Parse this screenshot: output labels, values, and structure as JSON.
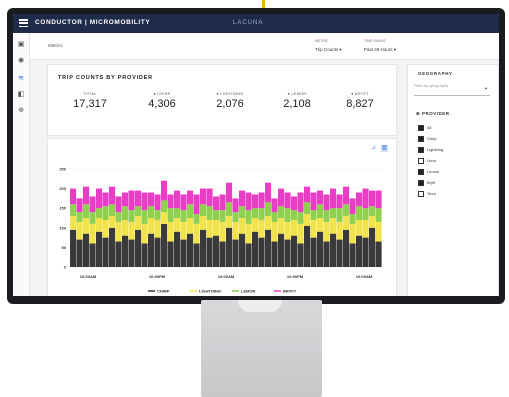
{
  "app": {
    "title": "CONDUCTOR | MICROMOBILITY",
    "brand": "LACUNA"
  },
  "header": {
    "breadcrumb": "Metrics",
    "metric": {
      "label": "METRIC",
      "value": "Trip Counts ▾"
    },
    "time_range": {
      "label": "TIME RANGE",
      "value": "Past 48 Hours ▾"
    }
  },
  "sidebar": {
    "icons": [
      "layers-icon",
      "globe-icon",
      "bike-icon",
      "code-icon",
      "world-icon"
    ]
  },
  "trip_counts": {
    "title": "TRIP COUNTS BY PROVIDER",
    "stats": [
      {
        "label": "TOTAL",
        "value": "17,317"
      },
      {
        "label": "● CHIRP",
        "value": "4,306"
      },
      {
        "label": "● LIGHTNING",
        "value": "2,076"
      },
      {
        "label": "● LEMON",
        "value": "2,108"
      },
      {
        "label": "● BRYFT",
        "value": "8,827"
      }
    ]
  },
  "geography": {
    "title": "GEOGRAPHY",
    "placeholder": "Filter by geography",
    "providers_title": "⊕ PROVIDER",
    "providers": [
      {
        "label": "All",
        "checked": true
      },
      {
        "label": "Chirp",
        "checked": true
      },
      {
        "label": "Lightning",
        "checked": true
      },
      {
        "label": "Lima",
        "checked": false
      },
      {
        "label": "Lemon",
        "checked": true
      },
      {
        "label": "Bryft",
        "checked": true
      },
      {
        "label": "Texxi",
        "checked": false
      }
    ]
  },
  "colors": {
    "chirp": "#3a3a3c",
    "lightning": "#f2e34c",
    "lemon": "#8fd14f",
    "bryft": "#e83dc4",
    "accent": "#3b6fd6"
  },
  "chart_data": {
    "type": "bar",
    "stacked": true,
    "y_ticks": [
      "250",
      "200",
      "150",
      "100",
      "50",
      "0"
    ],
    "ylim": [
      0,
      250
    ],
    "x_ticks": [
      "10:00AM",
      "10:00PM",
      "10:00AM",
      "10:00PM",
      "10:00AM"
    ],
    "legend": [
      "CHIRP",
      "LIGHTNING",
      "LEMON",
      "BRYFT"
    ],
    "series": [
      {
        "name": "CHIRP",
        "values": [
          95,
          70,
          85,
          60,
          90,
          75,
          100,
          65,
          80,
          70,
          95,
          60,
          85,
          75,
          110,
          65,
          90,
          70,
          85,
          60,
          95,
          75,
          80,
          65,
          100,
          70,
          85,
          60,
          90,
          75,
          95,
          65,
          85,
          70,
          80,
          60,
          105,
          75,
          90,
          65,
          85,
          70,
          95,
          60,
          80,
          75,
          100,
          65
        ]
      },
      {
        "name": "LIGHTNING",
        "values": [
          35,
          45,
          40,
          50,
          35,
          45,
          30,
          50,
          40,
          45,
          35,
          50,
          40,
          45,
          30,
          50,
          35,
          45,
          40,
          50,
          35,
          45,
          40,
          50,
          30,
          45,
          40,
          50,
          35,
          45,
          35,
          50,
          40,
          45,
          40,
          50,
          30,
          45,
          35,
          50,
          40,
          45,
          35,
          50,
          40,
          45,
          30,
          50
        ]
      },
      {
        "name": "LEMON",
        "values": [
          30,
          25,
          35,
          30,
          25,
          35,
          30,
          25,
          35,
          30,
          25,
          35,
          30,
          25,
          30,
          35,
          25,
          30,
          35,
          25,
          30,
          35,
          25,
          30,
          35,
          25,
          30,
          35,
          25,
          30,
          35,
          25,
          30,
          35,
          25,
          30,
          30,
          25,
          35,
          30,
          25,
          35,
          30,
          25,
          35,
          30,
          25,
          35
        ]
      },
      {
        "name": "BRYFT",
        "values": [
          40,
          35,
          45,
          40,
          50,
          35,
          45,
          40,
          35,
          50,
          40,
          45,
          35,
          40,
          50,
          35,
          45,
          40,
          35,
          50,
          40,
          45,
          35,
          40,
          50,
          35,
          40,
          45,
          35,
          40,
          50,
          35,
          45,
          40,
          35,
          50,
          40,
          45,
          35,
          40,
          50,
          35,
          45,
          40,
          35,
          50,
          40,
          45
        ]
      }
    ]
  }
}
